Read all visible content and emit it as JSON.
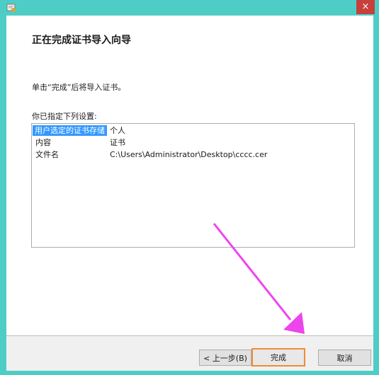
{
  "window": {
    "close_glyph": "×",
    "app_icon": "certificate-wizard-icon"
  },
  "page": {
    "title": "正在完成证书导入向导",
    "instruction": "单击“完成”后将导入证书。",
    "settings_label": "你已指定下列设置:"
  },
  "settings": [
    {
      "key": "用户选定的证书存储",
      "value": "个人"
    },
    {
      "key": "内容",
      "value": "证书"
    },
    {
      "key": "文件名",
      "value": "C:\\Users\\Administrator\\Desktop\\cccc.cer"
    }
  ],
  "buttons": {
    "back": "< 上一步(B)",
    "finish": "完成",
    "cancel": "取消"
  },
  "colors": {
    "accent": "#3399ff",
    "focus": "#f28a33",
    "arrow": "#ee44ee",
    "titlebar": "#4ecdc7"
  }
}
